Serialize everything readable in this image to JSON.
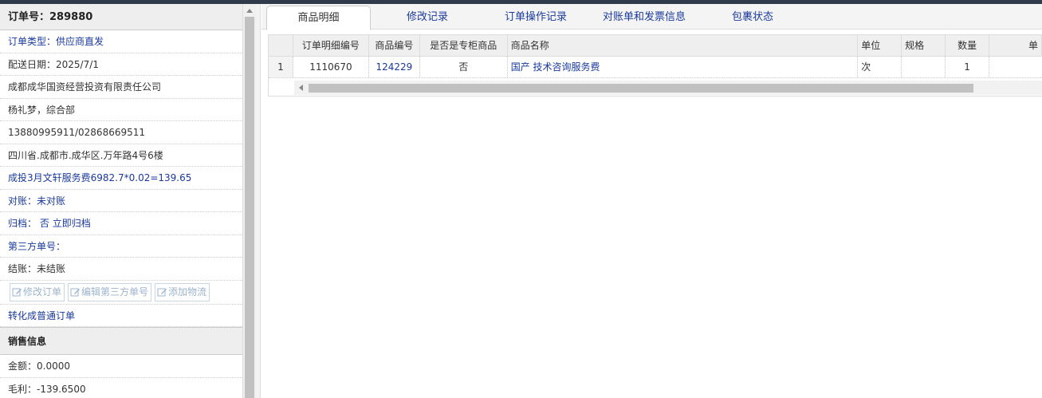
{
  "order": {
    "number_label": "订单号：",
    "number": "289880",
    "type": "订单类型：供应商直发",
    "delivery": "配送日期：2025/7/1",
    "company": "成都成华国资经营投资有限责任公司",
    "contact": "杨礼梦，综合部",
    "phone": "13880995911/02868669511",
    "address": "四川省.成都市.成华区.万年路4号6楼",
    "remark": "成投3月文轩服务费6982.7*0.02=139.65",
    "reconcile": "对账：未对账",
    "archive_label": "归档：",
    "archive_value": "否",
    "archive_link": "立即归档",
    "third_party": "第三方单号：",
    "settle": "结账：未结账",
    "buttons": {
      "edit_order": "修改订单",
      "edit_third": "编辑第三方单号",
      "add_logistics": "添加物流"
    },
    "convert": "转化成普通订单"
  },
  "sales": {
    "title": "销售信息",
    "amount": "金额：0.0000",
    "profit": "毛利：-139.6500"
  },
  "tabs": [
    {
      "label": "商品明细"
    },
    {
      "label": "修改记录"
    },
    {
      "label": "订单操作记录"
    },
    {
      "label": "对账单和发票信息"
    },
    {
      "label": "包裹状态"
    }
  ],
  "grid": {
    "headers": [
      "订单明细编号",
      "商品编号",
      "是否是专柜商品",
      "商品名称",
      "单位",
      "规格",
      "数量",
      "单"
    ],
    "rows": [
      {
        "index": "1",
        "detail_no": "1110670",
        "product_no": "124229",
        "is_counter": "否",
        "name": "国产 技术咨询服务费",
        "unit": "次",
        "spec": "",
        "qty": "1",
        "extra": ""
      }
    ]
  }
}
